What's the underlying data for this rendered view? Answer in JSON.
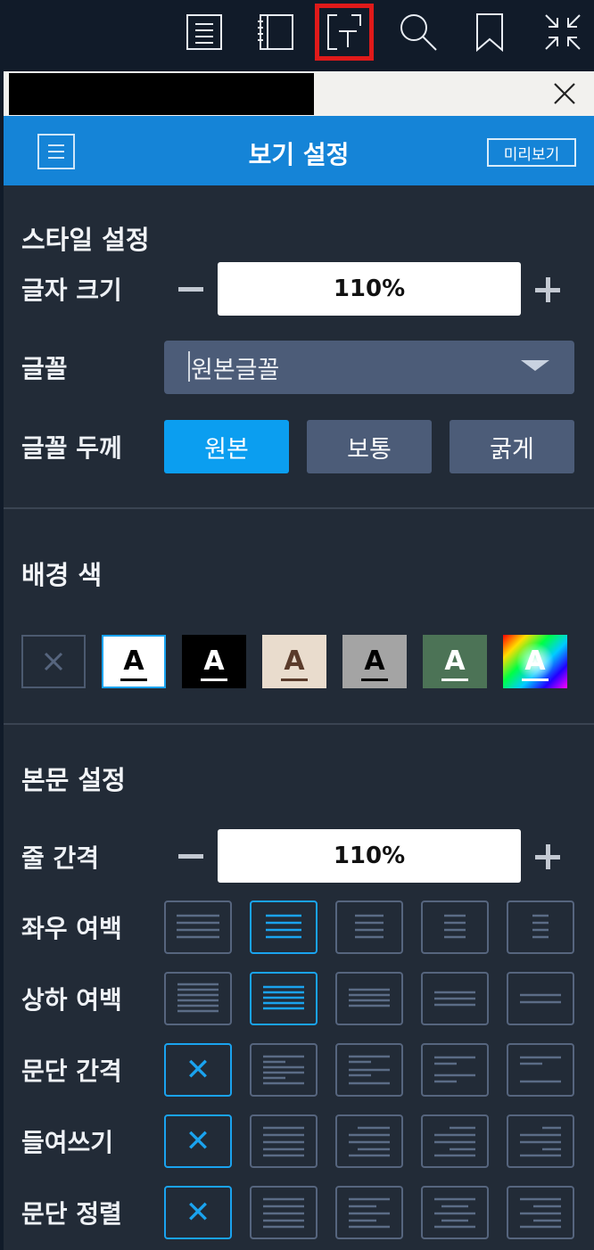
{
  "toolbar": {
    "icons": [
      "list-icon",
      "notebook-icon",
      "text-settings-icon",
      "search-icon",
      "bookmark-icon",
      "collapse-icon"
    ],
    "active": "text-settings-icon"
  },
  "panel": {
    "title": "보기 설정",
    "preview_label": "미리보기",
    "close_icon": "close-icon"
  },
  "style_section": {
    "title": "스타일 설정",
    "font_size_label": "글자 크기",
    "font_size_value": "110%",
    "font_label": "글꼴",
    "font_value": "원본글꼴",
    "weight_label": "글꼴 두께",
    "weight_options": [
      "원본",
      "보통",
      "굵게"
    ],
    "weight_selected": "원본"
  },
  "background_section": {
    "title": "배경 색",
    "swatch_letter": "A",
    "swatches": [
      {
        "name": "none",
        "bg": "#222b37",
        "fg": "#56657e"
      },
      {
        "name": "white",
        "bg": "#ffffff",
        "fg": "#000000"
      },
      {
        "name": "black",
        "bg": "#000000",
        "fg": "#ffffff"
      },
      {
        "name": "beige",
        "bg": "#e9dccd",
        "fg": "#5a3b2b"
      },
      {
        "name": "gray",
        "bg": "#a4a4a4",
        "fg": "#000000"
      },
      {
        "name": "green",
        "bg": "#4c7356",
        "fg": "#ffffff"
      },
      {
        "name": "custom",
        "bg": "rainbow",
        "fg": "#ffffff"
      }
    ],
    "selected": "white"
  },
  "body_section": {
    "title": "본문 설정",
    "line_spacing_label": "줄 간격",
    "line_spacing_value": "110%",
    "lr_margin_label": "좌우 여백",
    "tb_margin_label": "상하 여백",
    "paragraph_spacing_label": "문단 간격",
    "indent_label": "들여쓰기",
    "alignment_label": "문단 정렬",
    "none_symbol": "✕"
  },
  "colors": {
    "accent": "#1aa3ef",
    "title_bar": "#1584d7",
    "panel_bg": "#222b37",
    "button_bg": "#4c5c78"
  }
}
